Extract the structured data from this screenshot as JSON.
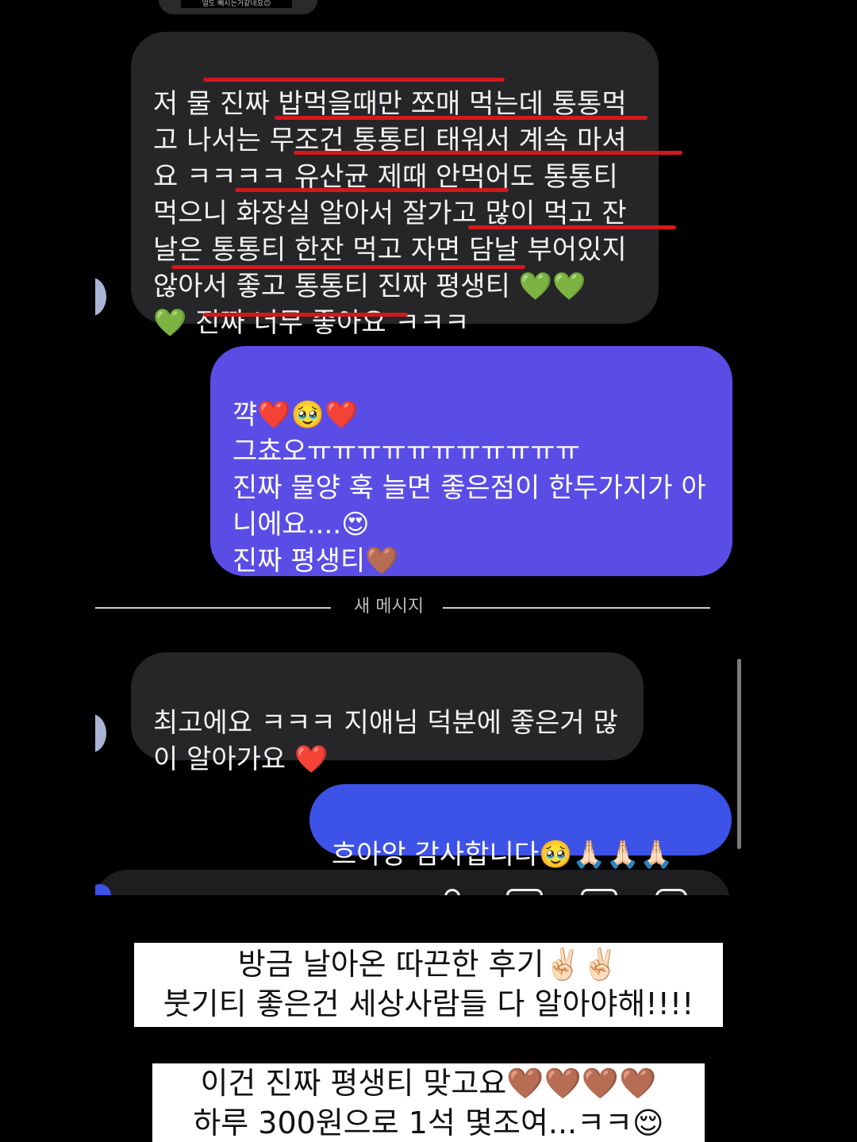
{
  "top_stub_text": "얼도 빼시는거같네요😊",
  "messages": {
    "m1": "저 물 진짜 밥먹을때만 쪼매 먹는데 통통먹\n고 나서는 무조건 통통티 태워서 계속 마셔\n요 ㅋㅋㅋㅋ 유산균 제때 안먹어도 통통티\n먹으니 화장실 알아서 잘가고 많이 먹고 잔\n날은 통통티 한잔 먹고 자면 담날 부어있지\n않아서 좋고 통통티 진짜 평생티 💚💚\n💚 진짜 너무 좋아요 ㅋㅋㅋ",
    "m2": "꺅❤️🥹❤️\n그쵸오ㅠㅠㅠㅠㅠㅠㅠㅠㅠㅠㅠ\n진짜 물양 훅 늘면 좋은점이 한두가지가 아\n니에요....😍\n진짜 평생티🤎",
    "m3": "최고에요 ㅋㅋㅋ 지애님 덕분에 좋은거 많\n이 알아가요 ❤️",
    "m4": "흐아앙 감사합니다🥹🙏🏻🙏🏻🙏🏻"
  },
  "divider_label": "새 메시지",
  "captions": {
    "cap1_line1": "방금 날아온 따끈한 후기✌🏻✌🏻",
    "cap1_line2": "붓기티 좋은건 세상사람들 다 알아야해!!!!",
    "cap2_line1": "이건 진짜 평생티 맞고요🤎🤎🤎🤎",
    "cap2_line2": "하루 300원으로 1석 몇조여...ㅋㅋ😌"
  },
  "colors": {
    "incoming_bubble": "#262628",
    "outgoing_bubble_purple": "#5a4de6",
    "outgoing_bubble_blue": "#3d52e6",
    "underline_red": "#d3181c"
  }
}
